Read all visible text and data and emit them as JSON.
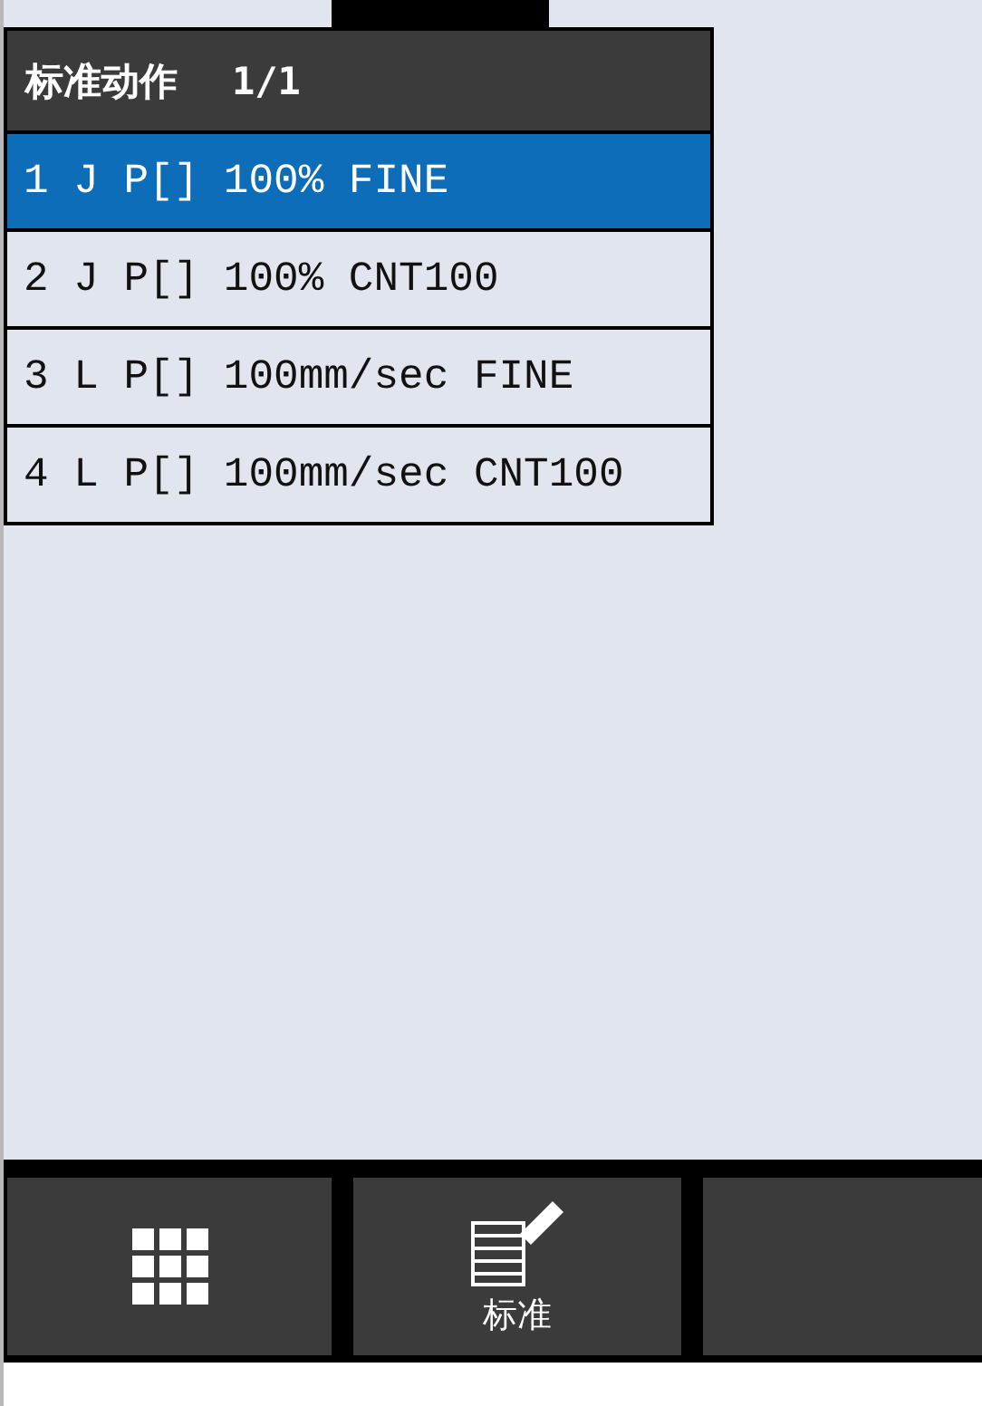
{
  "menu": {
    "title": "标准动作",
    "page": "1/1",
    "items": [
      {
        "label": "1 J P[] 100% FINE",
        "selected": true
      },
      {
        "label": "2 J P[] 100% CNT100",
        "selected": false
      },
      {
        "label": "3 L P[] 100mm/sec FINE",
        "selected": false
      },
      {
        "label": "4 L P[] 100mm/sec CNT100",
        "selected": false
      }
    ]
  },
  "toolbar": [
    {
      "kind": "grid"
    },
    {
      "kind": "edit",
      "label": "标准"
    },
    {
      "kind": "blank"
    }
  ]
}
